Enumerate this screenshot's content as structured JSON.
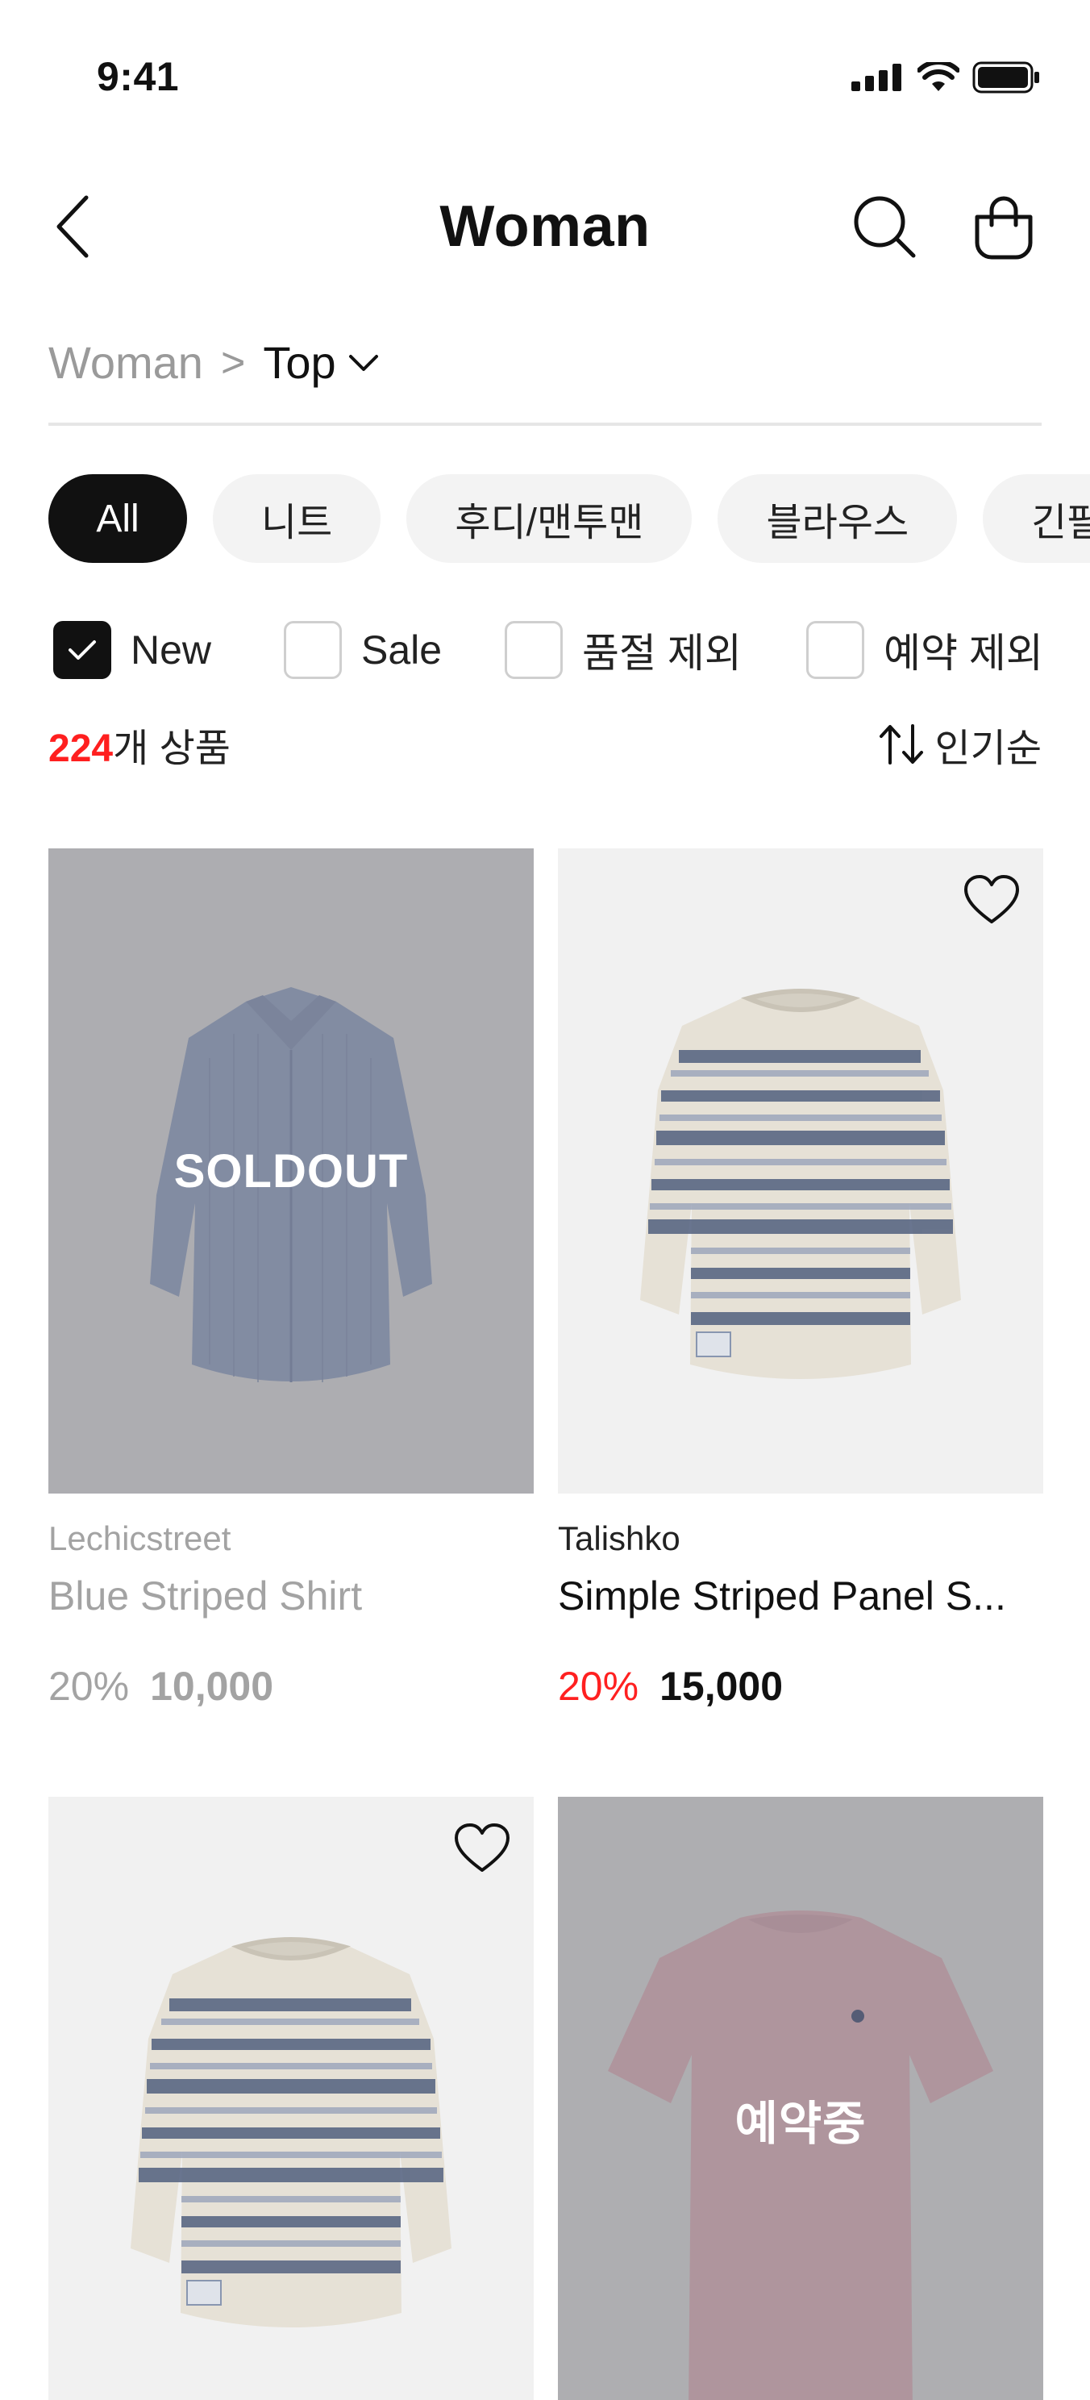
{
  "status_bar": {
    "time": "9:41"
  },
  "header": {
    "title": "Woman"
  },
  "breadcrumb": {
    "root": "Woman",
    "separator": ">",
    "current": "Top"
  },
  "categories": [
    {
      "label": "All",
      "active": true
    },
    {
      "label": "니트",
      "active": false
    },
    {
      "label": "후디/맨투맨",
      "active": false
    },
    {
      "label": "블라우스",
      "active": false
    },
    {
      "label": "긴팔",
      "active": false
    }
  ],
  "filters": [
    {
      "label": "New",
      "checked": true
    },
    {
      "label": "Sale",
      "checked": false
    },
    {
      "label": "품절 제외",
      "checked": false
    },
    {
      "label": "예약 제외",
      "checked": false
    }
  ],
  "results": {
    "count": "224",
    "count_suffix": "개 상품",
    "sort_label": "인기순"
  },
  "products": [
    {
      "brand": "Lechicstreet",
      "name": "Blue Striped Shirt",
      "discount": "20%",
      "price": "10,000",
      "overlay": "SOLDOUT",
      "image": "blue-striped-shirt",
      "wishlist": false
    },
    {
      "brand": "Talishko",
      "name": "Simple Striped Panel S...",
      "discount": "20%",
      "price": "15,000",
      "overlay": "",
      "image": "striped-sweatshirt",
      "wishlist": true
    },
    {
      "brand": "",
      "name": "",
      "discount": "",
      "price": "",
      "overlay": "",
      "image": "striped-sweatshirt",
      "wishlist": true
    },
    {
      "brand": "",
      "name": "",
      "discount": "",
      "price": "",
      "overlay": "예약중",
      "image": "pink-tshirt",
      "wishlist": false
    }
  ],
  "colors": {
    "accent_red": "#ff1f1f",
    "chip_active": "#111111",
    "chip_bg": "#f3f3f3",
    "muted_text": "#a3a3a3"
  },
  "icons": [
    "back-icon",
    "search-icon",
    "cart-icon",
    "chevron-down-icon",
    "check-icon",
    "sort-icon",
    "heart-icon"
  ]
}
